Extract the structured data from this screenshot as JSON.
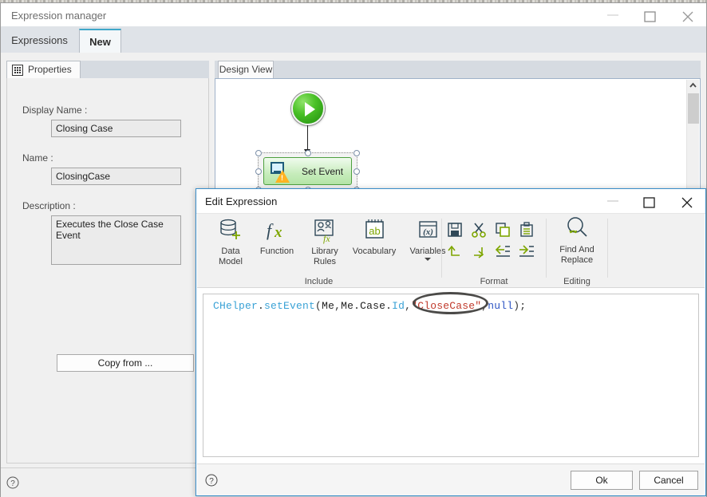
{
  "main_window": {
    "title": "Expression manager",
    "controls": {
      "minimize": "minimize-icon",
      "maximize": "maximize-icon",
      "close": "close-icon"
    },
    "tabs": [
      {
        "label": "Expressions",
        "active": false
      },
      {
        "label": "New",
        "active": true
      }
    ],
    "help_icon": "help-icon"
  },
  "properties_panel": {
    "tab_label": "Properties",
    "tab_icon": "properties-icon",
    "fields": [
      {
        "label": "Display Name :",
        "value": "Closing Case"
      },
      {
        "label": "Name :",
        "value": "ClosingCase"
      },
      {
        "label": "Description :",
        "value": "Executes the Close Case Event"
      }
    ],
    "copy_from_button": "Copy from ..."
  },
  "design_panel": {
    "tab_label": "Design View",
    "nodes": [
      {
        "type": "start",
        "icon": "play-icon"
      },
      {
        "type": "activity",
        "label": "Set Event",
        "icon": "screen-icon",
        "badge": "warning-icon",
        "selected": true
      }
    ],
    "scrollbar": {
      "up_arrow": "chevron-up-icon"
    }
  },
  "dialog": {
    "title": "Edit Expression",
    "controls": {
      "minimize": "minimize-icon",
      "maximize": "maximize-icon",
      "close": "close-icon"
    },
    "ribbon": {
      "groups": [
        {
          "title": "Include",
          "items": [
            {
              "label": "Data\nModel",
              "label_line1": "Data",
              "label_line2": "Model",
              "icon": "database-add-icon"
            },
            {
              "label": "Function",
              "label_line1": "Function",
              "label_line2": "",
              "icon": "fx-icon"
            },
            {
              "label": "Library\nRules",
              "label_line1": "Library",
              "label_line2": "Rules",
              "icon": "library-rules-icon"
            },
            {
              "label": "Vocabulary",
              "label_line1": "Vocabulary",
              "label_line2": "",
              "icon": "vocabulary-icon"
            },
            {
              "label": "Variables",
              "label_line1": "Variables",
              "label_line2": "",
              "icon": "variables-icon",
              "has_dropdown": true
            }
          ]
        },
        {
          "title": "Format",
          "items": [
            {
              "icon": "save-icon"
            },
            {
              "icon": "cut-icon"
            },
            {
              "icon": "copy-icon"
            },
            {
              "icon": "paste-icon"
            },
            {
              "icon": "undo-icon"
            },
            {
              "icon": "redo-icon"
            },
            {
              "icon": "outdent-icon"
            },
            {
              "icon": "indent-icon"
            }
          ]
        },
        {
          "title": "Editing",
          "items": [
            {
              "label_line1": "Find And",
              "label_line2": "Replace",
              "icon": "find-replace-icon"
            }
          ]
        }
      ]
    },
    "editor": {
      "code_tokens": [
        {
          "text": "CHelper",
          "kind": "identifier"
        },
        {
          "text": ".",
          "kind": "punct"
        },
        {
          "text": "setEvent",
          "kind": "identifier"
        },
        {
          "text": "(",
          "kind": "punct"
        },
        {
          "text": "Me",
          "kind": "plain"
        },
        {
          "text": ",",
          "kind": "punct"
        },
        {
          "text": "Me",
          "kind": "plain"
        },
        {
          "text": ".",
          "kind": "punct"
        },
        {
          "text": "Case",
          "kind": "plain"
        },
        {
          "text": ".",
          "kind": "punct"
        },
        {
          "text": "Id",
          "kind": "identifier"
        },
        {
          "text": ",",
          "kind": "punct"
        },
        {
          "text": "\"CloseCase\"",
          "kind": "string"
        },
        {
          "text": ",",
          "kind": "punct"
        },
        {
          "text": "null",
          "kind": "keyword"
        },
        {
          "text": ");",
          "kind": "punct"
        }
      ],
      "code_plain": "CHelper.setEvent(Me,Me.Case.Id,\"CloseCase\",null);",
      "annotation": {
        "shape": "ellipse",
        "target_text": "\"CloseCase\"",
        "color": "#4b4a48"
      }
    },
    "help_icon": "help-icon",
    "buttons": [
      {
        "label": "Ok",
        "name": "ok-button"
      },
      {
        "label": "Cancel",
        "name": "cancel-button"
      }
    ]
  },
  "colors": {
    "dialog_border": "#3a8ec9",
    "tab_accent": "#3fa7c9",
    "ribbon_green": "#7ea600",
    "ribbon_navy": "#2f4858",
    "string_red": "#c0392b",
    "identifier_blue": "#3aa2d6",
    "keyword_blue": "#2d55c4",
    "node_green": "#4ea03f"
  }
}
